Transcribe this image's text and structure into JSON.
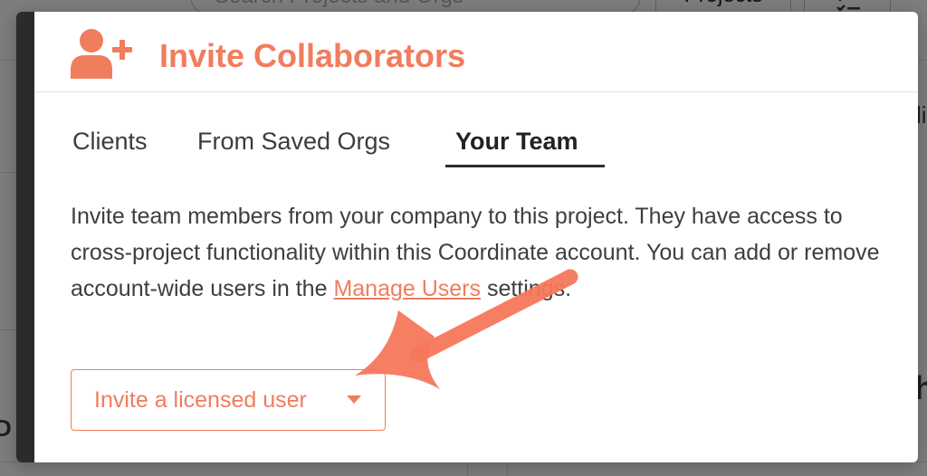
{
  "background": {
    "search_placeholder": "Search Projects and Orgs",
    "projects_tab_label": "Projects",
    "right_fragment_top": "li",
    "right_fragment_mid": "h",
    "left_fragment": "D"
  },
  "modal": {
    "icon": "person-add-icon",
    "title": "Invite Collaborators",
    "tabs": [
      {
        "label": "Clients"
      },
      {
        "label": "From Saved Orgs"
      },
      {
        "label": "Your Team"
      }
    ],
    "active_tab": "Your Team",
    "description": {
      "text": "Invite team members from your company to this project. They have access to cross-project functionality within this Coordinate account. You can add or remove account-wide users in the ",
      "link_label": "Manage Users",
      "suffix": " settings."
    },
    "invite_button": {
      "label": "Invite a licensed user",
      "icon": "caret-down-icon"
    }
  },
  "annotation": {
    "icon": "arrow-annotation-icon"
  },
  "colors": {
    "accent": "#f07d5e",
    "annotation_arrow": "#f5775a",
    "overlay": "#7d7d7d",
    "modal_edge": "#2b2b2b"
  }
}
